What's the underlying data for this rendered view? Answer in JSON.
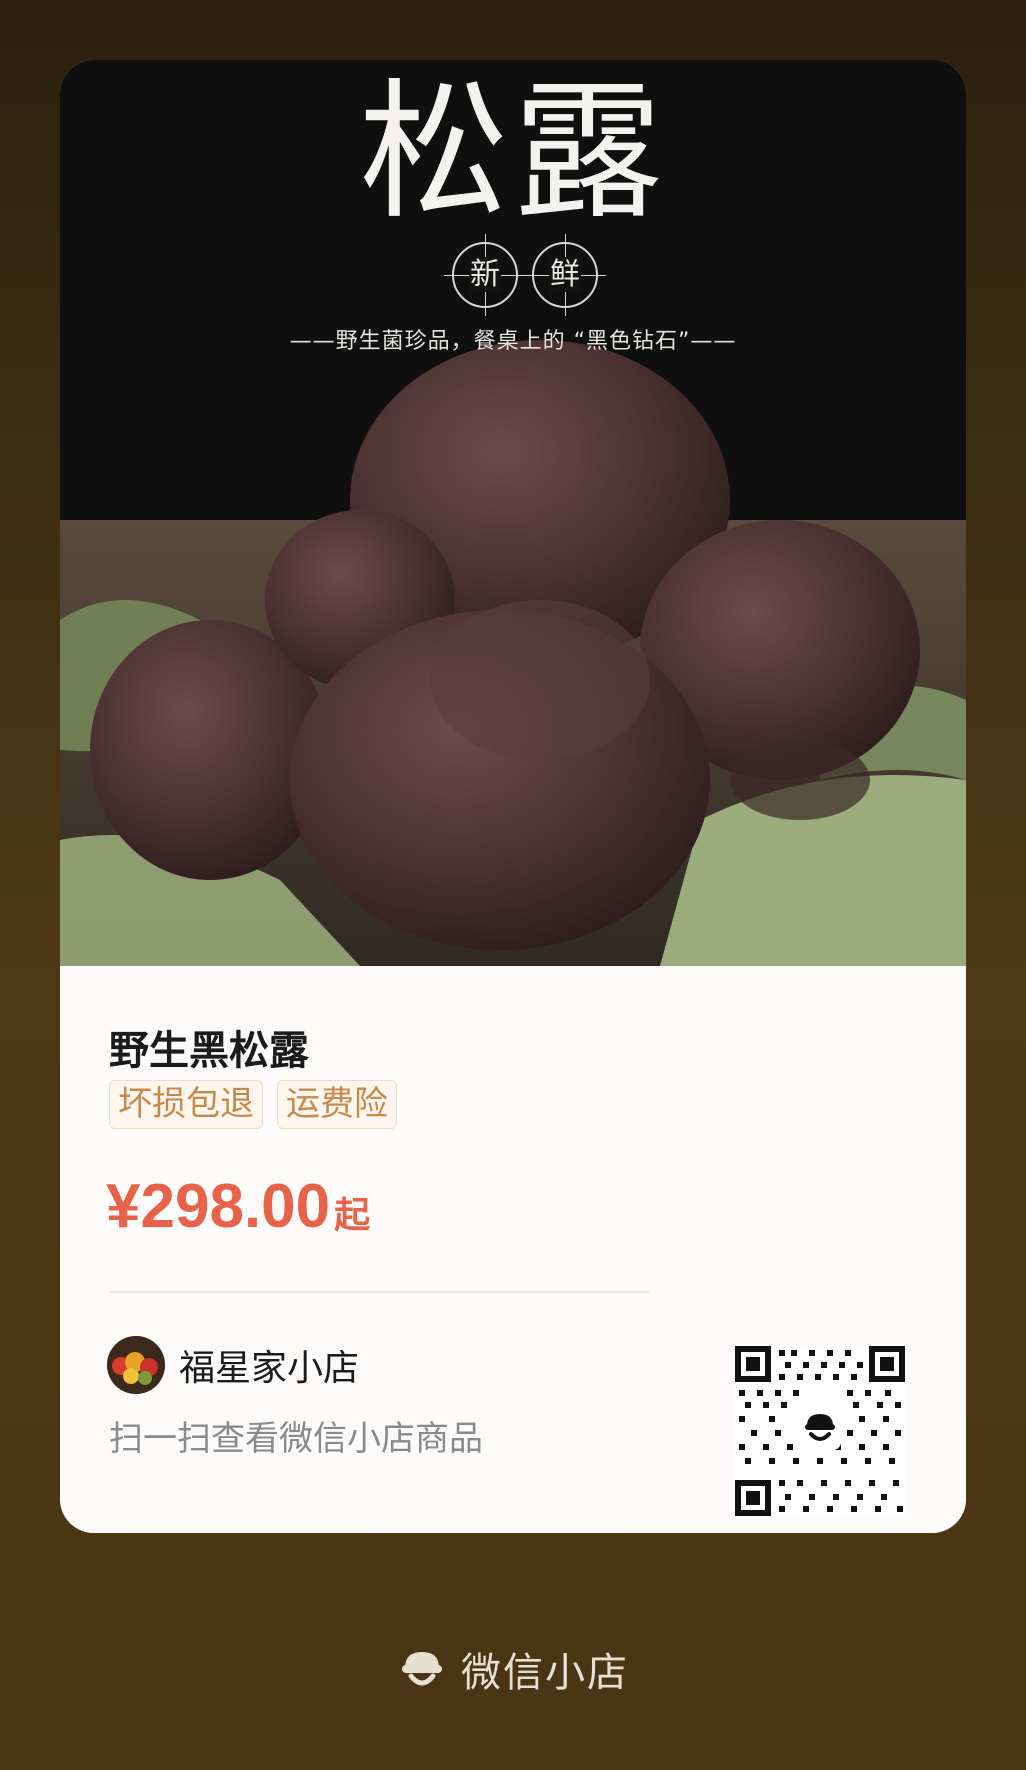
{
  "product_card": {
    "hero": {
      "title": "松露",
      "seal_left": "新",
      "seal_right": "鲜",
      "subtitle": "——野生菌珍品，餐桌上的 “黑色钻石”——"
    },
    "product_name": "野生黑松露",
    "tags": [
      "坏损包退",
      "运费险"
    ],
    "price": {
      "amount": "¥298.00",
      "suffix": "起"
    },
    "shop": {
      "name": "福星家小店",
      "scan_hint": "扫一扫查看微信小店商品"
    }
  },
  "footer": {
    "brand_label": "微信小店",
    "brand_icon": "wechat-shop-icon"
  },
  "colors": {
    "price": "#e8624a",
    "tag_text": "#c7894a",
    "background": "#4a3614"
  }
}
